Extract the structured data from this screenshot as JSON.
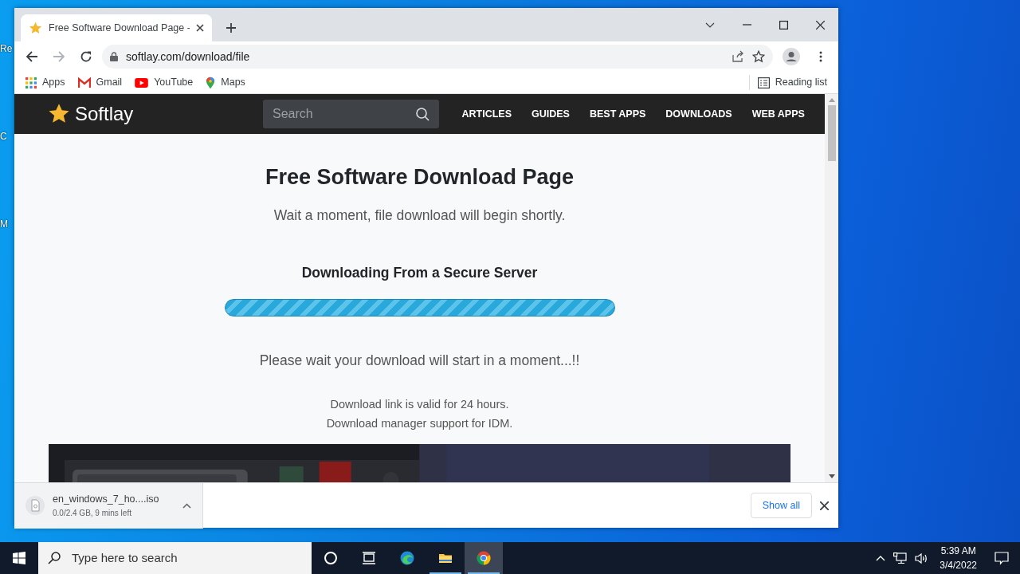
{
  "desktop_icons": [
    {
      "label": "Re"
    },
    {
      "label": "C"
    },
    {
      "label": "M"
    }
  ],
  "browser": {
    "tabs": [
      {
        "title": "Free Software Download Page -",
        "selected": true
      }
    ],
    "address": "softlay.com/download/file",
    "bookmarks": [
      {
        "kind": "apps",
        "label": "Apps"
      },
      {
        "kind": "gmail",
        "label": "Gmail"
      },
      {
        "kind": "youtube",
        "label": "YouTube"
      },
      {
        "kind": "maps",
        "label": "Maps"
      }
    ],
    "reading_list": "Reading list"
  },
  "site": {
    "brand": "Softlay",
    "search_placeholder": "Search",
    "nav": [
      "ARTICLES",
      "GUIDES",
      "BEST APPS",
      "DOWNLOADS",
      "WEB APPS"
    ],
    "title": "Free Software Download Page",
    "subtitle": "Wait a moment, file download will begin shortly.",
    "server_heading": "Downloading From a Secure Server",
    "progress": {
      "level": 1
    },
    "wait_text": "Please wait your download will start in a moment...!!",
    "notes": [
      "Download link is valid for 24 hours.",
      "Download manager support for IDM."
    ]
  },
  "download_shelf": {
    "file": "en_windows_7_ho....iso",
    "status": "0.0/2.4 GB, 9 mins left",
    "show_all": "Show all"
  },
  "taskbar": {
    "search_placeholder": "Type here to search",
    "apps": [
      {
        "kind": "cortana",
        "running": false,
        "selected": false
      },
      {
        "kind": "taskview",
        "running": false,
        "selected": false
      },
      {
        "kind": "edge",
        "running": false,
        "selected": false
      },
      {
        "kind": "explorer",
        "running": true,
        "selected": false
      },
      {
        "kind": "chrome",
        "running": true,
        "selected": true
      }
    ],
    "time": "5:39 AM",
    "date": "3/4/2022"
  }
}
